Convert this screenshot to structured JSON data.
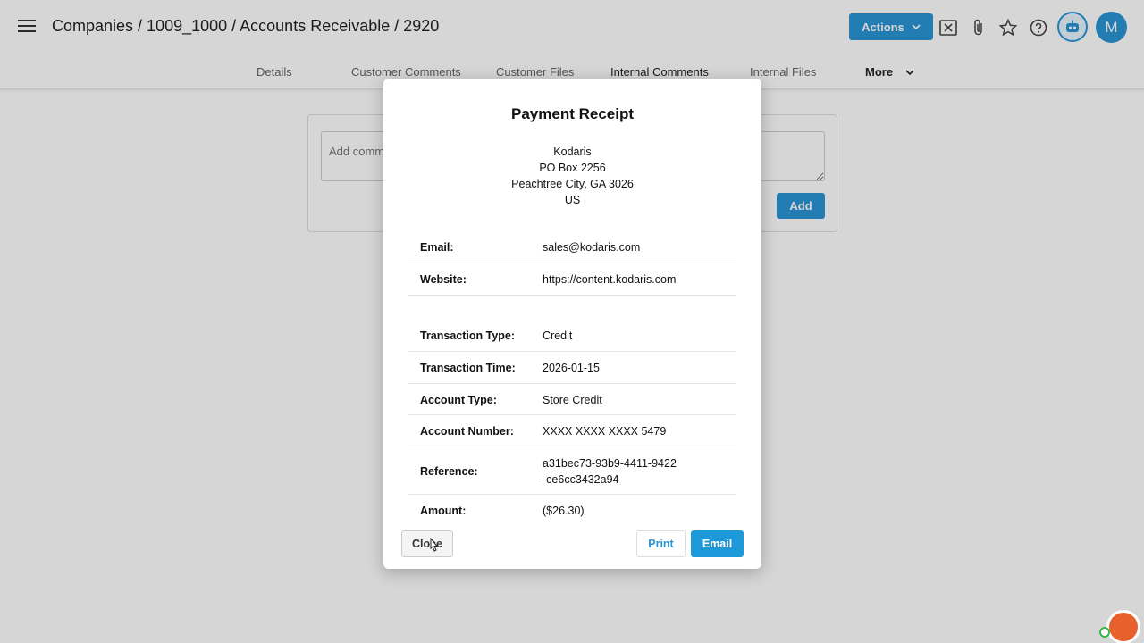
{
  "header": {
    "breadcrumb": "Companies / 1009_1000 / Accounts Receivable / 2920",
    "actions_label": "Actions",
    "avatar_initial": "M"
  },
  "tabs": [
    {
      "label": "Details"
    },
    {
      "label": "Customer Comments"
    },
    {
      "label": "Customer Files"
    },
    {
      "label": "Internal Comments"
    },
    {
      "label": "Internal Files"
    },
    {
      "label": "More"
    }
  ],
  "comments": {
    "placeholder": "Add comment",
    "add_label": "Add"
  },
  "receipt": {
    "title": "Payment Receipt",
    "address": [
      "Kodaris",
      "PO Box 2256",
      "Peachtree City, GA 3026",
      "US"
    ],
    "contact": [
      {
        "label": "Email:",
        "value": "sales@kodaris.com"
      },
      {
        "label": "Website:",
        "value": "https://content.kodaris.com"
      }
    ],
    "details": [
      {
        "label": "Transaction Type:",
        "value": "Credit"
      },
      {
        "label": "Transaction Time:",
        "value": "2026-01-15"
      },
      {
        "label": "Account Type:",
        "value": "Store Credit"
      },
      {
        "label": "Account Number:",
        "value": "XXXX XXXX XXXX 5479"
      },
      {
        "label": "Reference:",
        "value": "a31bec73-93b9-4411-9422-ce6cc3432a94"
      },
      {
        "label": "Amount:",
        "value": "($26.30)"
      }
    ],
    "close_label": "Close",
    "print_label": "Print",
    "email_label": "Email"
  },
  "colors": {
    "accent": "#2a95d4",
    "support_bubble": "#e8602c"
  }
}
